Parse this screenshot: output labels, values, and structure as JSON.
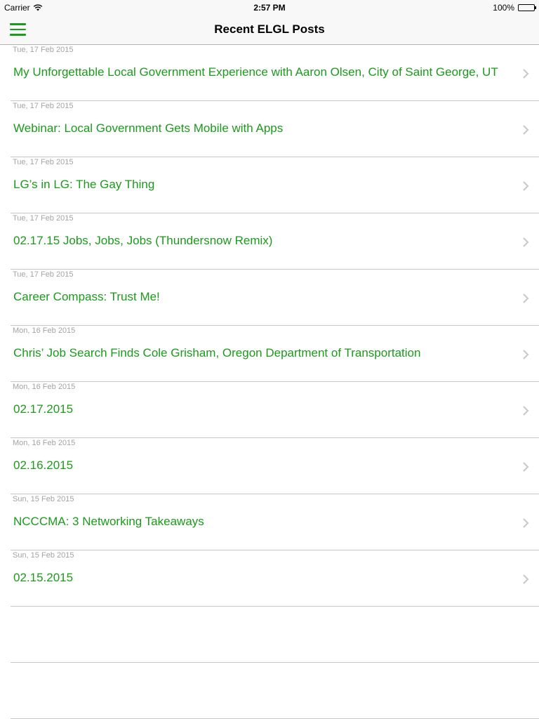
{
  "status_bar": {
    "carrier": "Carrier",
    "time": "2:57 PM",
    "battery": "100%"
  },
  "nav": {
    "title": "Recent ELGL Posts"
  },
  "colors": {
    "accent": "#1b9a1b",
    "date_text": "#a3a3a3",
    "separator": "#c8c7cc"
  },
  "posts": [
    {
      "date": "Tue, 17 Feb 2015",
      "title": "My Unforgettable Local Government Experience with Aaron Olsen, City of Saint George, UT"
    },
    {
      "date": "Tue, 17 Feb 2015",
      "title": "Webinar: Local Government Gets Mobile with Apps"
    },
    {
      "date": "Tue, 17 Feb 2015",
      "title": "LG’s in LG: The Gay Thing"
    },
    {
      "date": "Tue, 17 Feb 2015",
      "title": "02.17.15 Jobs, Jobs, Jobs (Thundersnow Remix)"
    },
    {
      "date": "Tue, 17 Feb 2015",
      "title": "Career Compass: Trust Me!"
    },
    {
      "date": "Mon, 16 Feb 2015",
      "title": "Chris’ Job Search Finds Cole Grisham, Oregon Department of Transportation"
    },
    {
      "date": "Mon, 16 Feb 2015",
      "title": "02.17.2015"
    },
    {
      "date": "Mon, 16 Feb 2015",
      "title": "02.16.2015"
    },
    {
      "date": "Sun, 15 Feb 2015",
      "title": "NCCCMA: 3 Networking Takeaways"
    },
    {
      "date": "Sun, 15 Feb 2015",
      "title": "02.15.2015"
    }
  ]
}
